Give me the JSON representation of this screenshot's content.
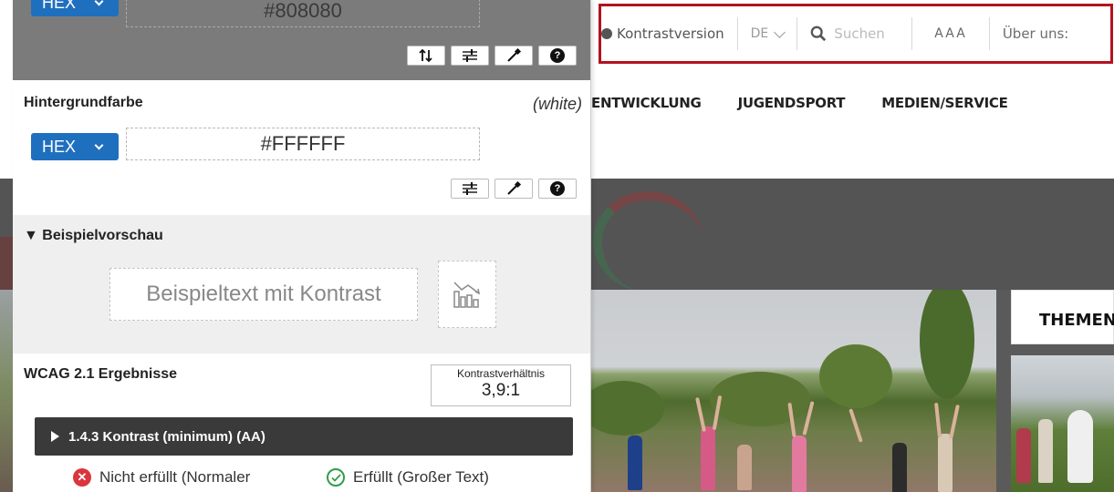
{
  "website": {
    "topbar": {
      "contrast_label": "Kontrastversion",
      "language": "DE",
      "search_placeholder": "Suchen",
      "font_size_label": "AAA",
      "about_label": "Über uns:"
    },
    "nav": [
      "ENTWICKLUNG",
      "JUGENDSPORT",
      "MEDIEN/SERVICE"
    ],
    "sidebar_heading": "THEMEN",
    "highlight_color": "#b3121e"
  },
  "checker": {
    "foreground": {
      "format": "HEX",
      "value": "#808080"
    },
    "background": {
      "title": "Hintergrundfarbe",
      "name_tag": "(white)",
      "format": "HEX",
      "value": "#FFFFFF"
    },
    "preview": {
      "title": "Beispielvorschau",
      "sample_text": "Beispieltext mit Kontrast"
    },
    "wcag": {
      "title": "WCAG 2.1 Ergebnisse",
      "ratio_label": "Kontrastverhältnis",
      "ratio_value": "3,9:1",
      "criterion": "1.4.3 Kontrast (minimum) (AA)",
      "result_normal": "Nicht erfüllt (Normaler",
      "result_large": "Erfüllt (Großer Text)"
    },
    "icons": {
      "swap": "swap-icon",
      "adjust": "sliders-icon",
      "picker": "eyedropper-icon",
      "help": "help-icon",
      "chart": "bar-chart-icon"
    },
    "colors": {
      "accent": "#1f6fbf",
      "fail": "#d9363e",
      "pass": "#2e9e48",
      "foreground_section_bg": "#7b7b7b"
    }
  }
}
